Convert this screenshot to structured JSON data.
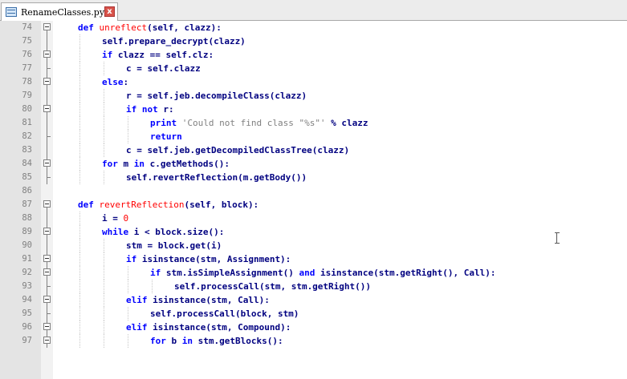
{
  "tab": {
    "title": "RenameClasses.py",
    "close_symbol": "x"
  },
  "lines": [
    {
      "n": "74",
      "segs": [
        [
          "kw",
          "def "
        ],
        [
          "fn",
          "unreflect"
        ],
        [
          "",
          "(self, clazz):"
        ]
      ]
    },
    {
      "n": "75",
      "segs": [
        [
          "",
          "self.prepare_decrypt(clazz)"
        ]
      ]
    },
    {
      "n": "76",
      "segs": [
        [
          "kw",
          "if "
        ],
        [
          "",
          "clazz == self.clz:"
        ]
      ]
    },
    {
      "n": "77",
      "segs": [
        [
          "",
          "c = self.clazz"
        ]
      ]
    },
    {
      "n": "78",
      "segs": [
        [
          "kw",
          "else"
        ],
        [
          "",
          ":"
        ]
      ]
    },
    {
      "n": "79",
      "segs": [
        [
          "",
          "r = self.jeb.decompileClass(clazz)"
        ]
      ]
    },
    {
      "n": "80",
      "segs": [
        [
          "kw",
          "if not "
        ],
        [
          "",
          "r:"
        ]
      ]
    },
    {
      "n": "81",
      "segs": [
        [
          "kw",
          "print "
        ],
        [
          "str",
          "'Could not find class \"%s\"'"
        ],
        [
          "",
          " % clazz"
        ]
      ]
    },
    {
      "n": "82",
      "segs": [
        [
          "kw",
          "return"
        ]
      ]
    },
    {
      "n": "83",
      "segs": [
        [
          "",
          "c = self.jeb.getDecompiledClassTree(clazz)"
        ]
      ]
    },
    {
      "n": "84",
      "segs": [
        [
          "kw",
          "for "
        ],
        [
          "",
          "m "
        ],
        [
          "kw",
          "in "
        ],
        [
          "",
          "c.getMethods():"
        ]
      ]
    },
    {
      "n": "85",
      "segs": [
        [
          "",
          "self.revertReflection(m.getBody())"
        ]
      ]
    },
    {
      "n": "86",
      "segs": []
    },
    {
      "n": "87",
      "segs": [
        [
          "kw",
          "def "
        ],
        [
          "fn",
          "revertReflection"
        ],
        [
          "",
          "(self, block):"
        ]
      ]
    },
    {
      "n": "88",
      "segs": [
        [
          "",
          "i = "
        ],
        [
          "num",
          "0"
        ]
      ]
    },
    {
      "n": "89",
      "segs": [
        [
          "kw",
          "while "
        ],
        [
          "",
          "i < block.size():"
        ]
      ]
    },
    {
      "n": "90",
      "segs": [
        [
          "",
          "stm = block.get(i)"
        ]
      ]
    },
    {
      "n": "91",
      "segs": [
        [
          "kw",
          "if "
        ],
        [
          "",
          "isinstance(stm, Assignment):"
        ]
      ]
    },
    {
      "n": "92",
      "segs": [
        [
          "kw",
          "if "
        ],
        [
          "",
          "stm.isSimpleAssignment() "
        ],
        [
          "kw",
          "and "
        ],
        [
          "",
          "isinstance(stm.getRight(), Call):"
        ]
      ]
    },
    {
      "n": "93",
      "segs": [
        [
          "",
          "self.processCall(stm, stm.getRight())"
        ]
      ]
    },
    {
      "n": "94",
      "segs": [
        [
          "kw",
          "elif "
        ],
        [
          "",
          "isinstance(stm, Call):"
        ]
      ]
    },
    {
      "n": "95",
      "segs": [
        [
          "",
          "self.processCall(block, stm)"
        ]
      ]
    },
    {
      "n": "96",
      "segs": [
        [
          "kw",
          "elif "
        ],
        [
          "",
          "isinstance(stm, Compound):"
        ]
      ]
    },
    {
      "n": "97",
      "segs": [
        [
          "kw",
          "for "
        ],
        [
          "",
          "b "
        ],
        [
          "kw",
          "in "
        ],
        [
          "",
          "stm.getBlocks():"
        ]
      ]
    }
  ]
}
